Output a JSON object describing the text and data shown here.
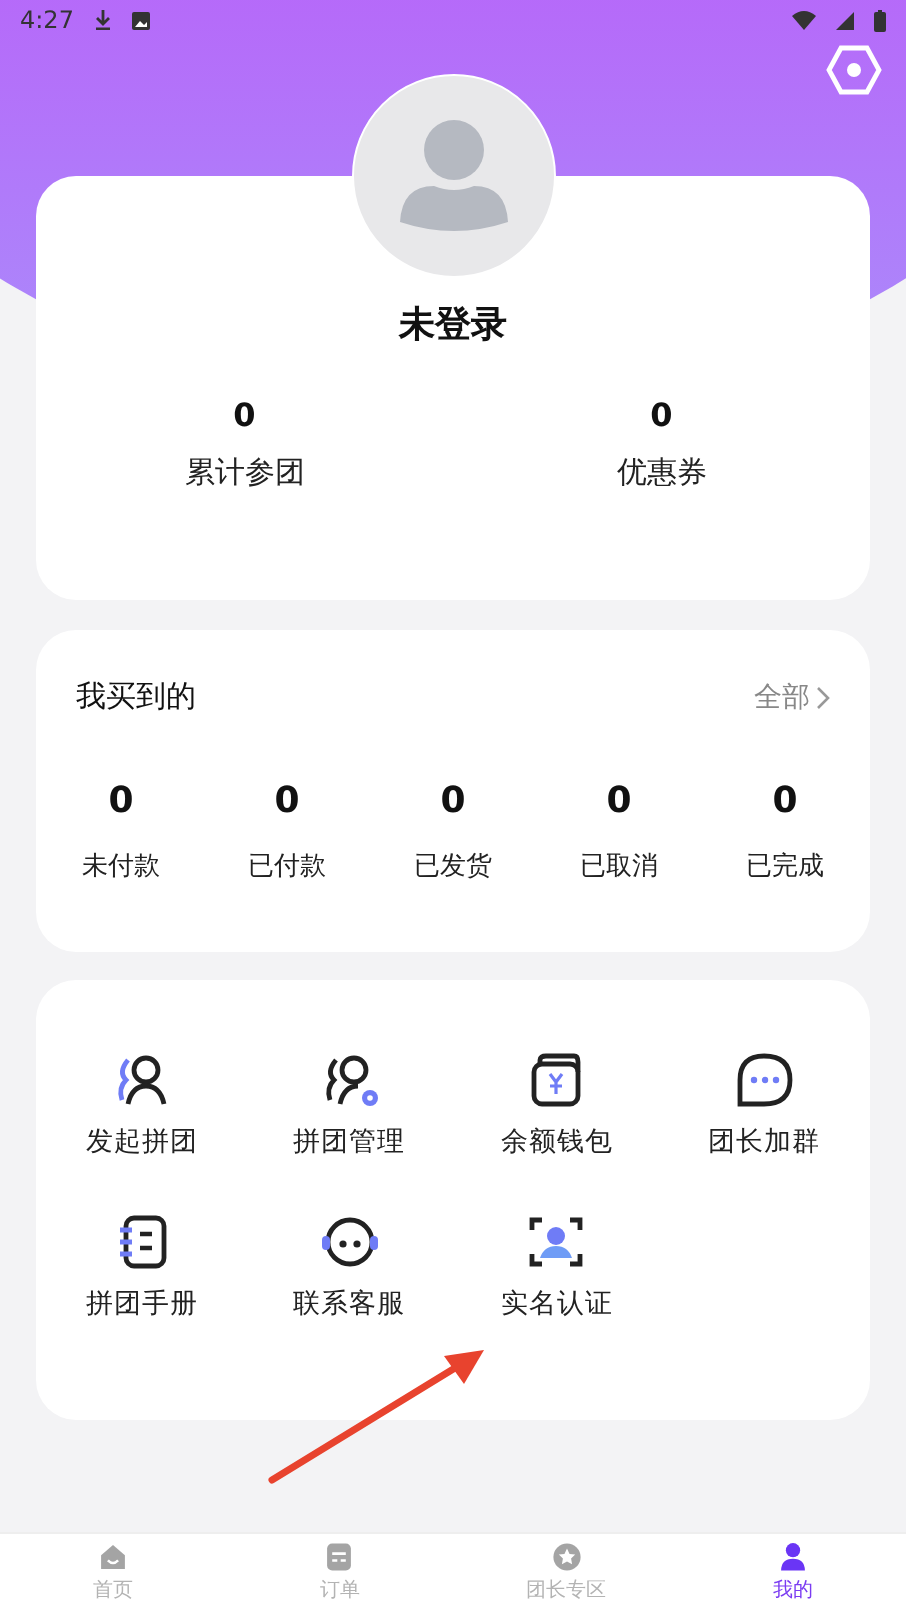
{
  "status_bar": {
    "time": "4:27"
  },
  "profile": {
    "name": "未登录",
    "stats": [
      {
        "value": "0",
        "label": "累计参团"
      },
      {
        "value": "0",
        "label": "优惠券"
      }
    ]
  },
  "orders": {
    "title": "我买到的",
    "more": "全部",
    "statuses": [
      {
        "value": "0",
        "label": "未付款"
      },
      {
        "value": "0",
        "label": "已付款"
      },
      {
        "value": "0",
        "label": "已发货"
      },
      {
        "value": "0",
        "label": "已取消"
      },
      {
        "value": "0",
        "label": "已完成"
      }
    ]
  },
  "services": [
    {
      "label": "发起拼团"
    },
    {
      "label": "拼团管理"
    },
    {
      "label": "余额钱包"
    },
    {
      "label": "团长加群"
    },
    {
      "label": "拼团手册"
    },
    {
      "label": "联系客服"
    },
    {
      "label": "实名认证"
    }
  ],
  "bottom_nav": [
    {
      "label": "首页",
      "selected": false
    },
    {
      "label": "订单",
      "selected": false
    },
    {
      "label": "团长专区",
      "selected": false
    },
    {
      "label": "我的",
      "selected": true
    }
  ]
}
